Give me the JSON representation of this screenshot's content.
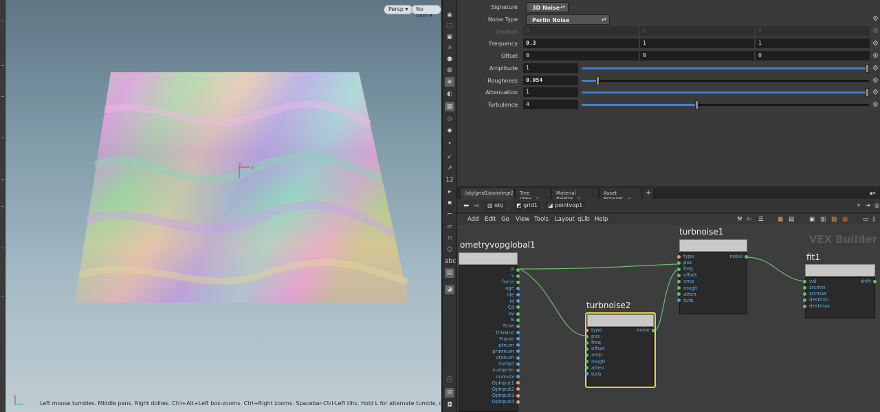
{
  "viewport": {
    "camera_menu": "Persp",
    "cam_menu": "No cam",
    "hint": "Left mouse tumbles. Middle pans. Right dollies. Ctrl+Alt+Left box-zooms. Ctrl+Right zooms. Spacebar-Ctrl-Left tilts. Hold L for alternate tumble, dolly, and zoom.",
    "axis_y": "y",
    "axis_x": "x",
    "tool_label_12": "12",
    "tool_label_abc": "abc"
  },
  "params": {
    "signature_label": "Signature",
    "signature_value": "3D Noise",
    "noise_type_label": "Noise Type",
    "noise_type_value": "Perlin Noise",
    "position_label": "Position",
    "position_values": [
      "0",
      "0",
      "0"
    ],
    "frequency_label": "Frequency",
    "frequency_values": [
      "0.3",
      "1",
      "1"
    ],
    "offset_label": "Offset",
    "offset_values": [
      "0",
      "0",
      "0"
    ],
    "amplitude_label": "Amplitude",
    "amplitude_value": "1",
    "amplitude_level": 1.0,
    "roughness_label": "Roughness",
    "roughness_value": "0.054",
    "roughness_level": 0.054,
    "attenuation_label": "Attenuation",
    "attenuation_value": "1",
    "attenuation_level": 1.0,
    "turbulence_label": "Turbulence",
    "turbulence_value": "4",
    "turbulence_level": 0.4
  },
  "tabs": [
    {
      "label": "/obj/grid1/pointvop1"
    },
    {
      "label": "Tree View"
    },
    {
      "label": "Material Palette"
    },
    {
      "label": "Asset Browser"
    }
  ],
  "path": {
    "obj": "obj",
    "grid": "grid1",
    "vop": "pointvop1"
  },
  "menus": [
    "Add",
    "Edit",
    "Go",
    "View",
    "Tools",
    "Layout",
    "qLib",
    "Help"
  ],
  "network": {
    "watermark": "VEX Builder",
    "global_node": {
      "title": "ometryvopglobal1",
      "outputs": [
        "P",
        "v",
        "force",
        "age",
        "life",
        "id",
        "Cd",
        "uv",
        "N",
        "Time",
        "TimeInc",
        "Frame",
        "ptnum",
        "primnum",
        "vtxnum",
        "numpt",
        "numprim",
        "numvtx",
        "OpInput1",
        "OpInput2",
        "OpInput3",
        "OpInput4"
      ]
    },
    "turbnoise1": {
      "title": "turbnoise1",
      "inputs": [
        "type",
        "pos",
        "freq",
        "offset",
        "amp",
        "rough",
        "atten",
        "turb"
      ],
      "output": "noise"
    },
    "turbnoise2": {
      "title": "turbnoise2",
      "inputs": [
        "type",
        "pos",
        "freq",
        "offset",
        "amp",
        "rough",
        "atten",
        "turb"
      ],
      "output": "noise"
    },
    "fit1": {
      "title": "fit1",
      "inputs": [
        "val",
        "srcmin",
        "srcmax",
        "destmin",
        "destmax"
      ],
      "output": "shift"
    }
  }
}
